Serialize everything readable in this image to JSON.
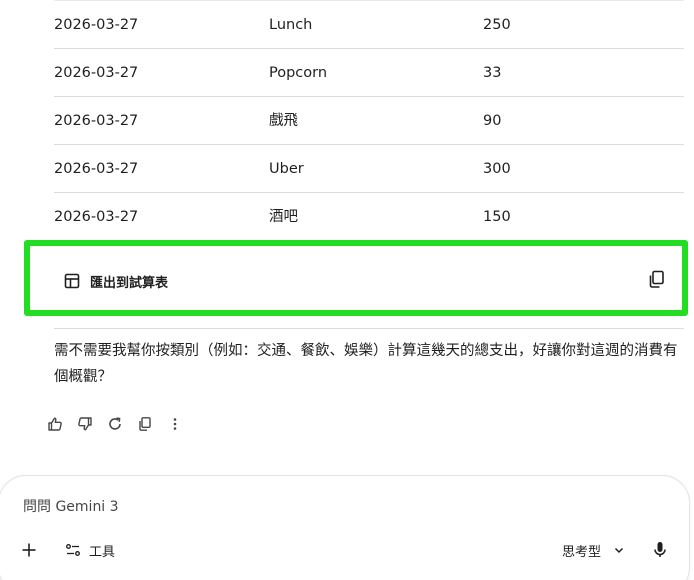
{
  "table": {
    "rows": [
      {
        "date": "2026-03-27",
        "item": "Lunch",
        "amount": "250"
      },
      {
        "date": "2026-03-27",
        "item": "Popcorn",
        "amount": "33"
      },
      {
        "date": "2026-03-27",
        "item": "戲飛",
        "amount": "90"
      },
      {
        "date": "2026-03-27",
        "item": "Uber",
        "amount": "300"
      },
      {
        "date": "2026-03-27",
        "item": "酒吧",
        "amount": "150"
      }
    ]
  },
  "export": {
    "label": "匯出到試算表",
    "icon": "table-icon",
    "copy_icon": "copy-icon"
  },
  "answer": {
    "text": "需不需要我幫你按類別（例如：交通、餐飲、娛樂）計算這幾天的總支出，好讓你對這週的消費有個概觀？"
  },
  "actions": [
    "thumbs-up-icon",
    "thumbs-down-icon",
    "regenerate-icon",
    "copy-icon",
    "more-vert-icon"
  ],
  "composer": {
    "placeholder": "問問 Gemini 3",
    "tools_label": "工具",
    "model_label": "思考型"
  },
  "colors": {
    "highlight": "#22dd22",
    "text": "#1f1f1f",
    "divider": "#dadce0",
    "icon": "#444746"
  }
}
